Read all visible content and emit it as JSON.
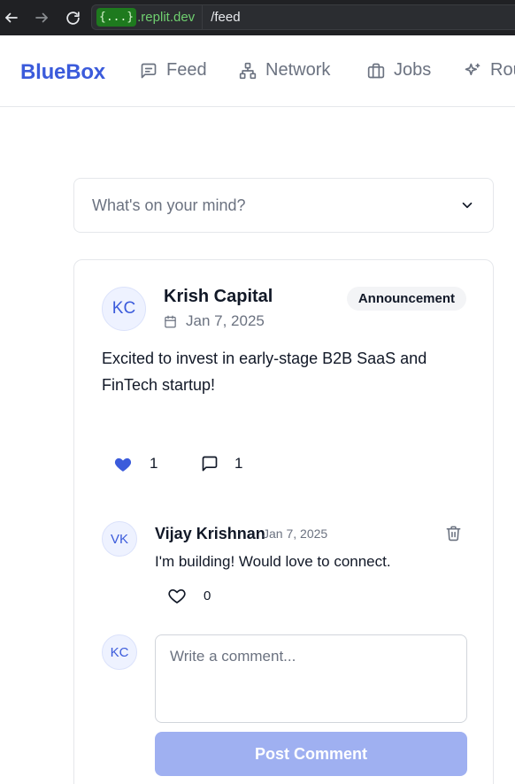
{
  "browser": {
    "host_badge": "{...}",
    "host": ".replit.dev",
    "path": "/feed"
  },
  "header": {
    "brand": "BlueBox",
    "nav": [
      {
        "label": "Feed",
        "icon": "message-square-icon"
      },
      {
        "label": "Network",
        "icon": "network-icon"
      },
      {
        "label": "Jobs",
        "icon": "briefcase-icon"
      },
      {
        "label": "Rou",
        "icon": "sparkles-icon"
      }
    ]
  },
  "composer": {
    "label": "What's on your mind?",
    "icon": "chevron-down-icon"
  },
  "post": {
    "avatar_initials": "KC",
    "author": "Krish Capital",
    "date": "Jan 7, 2025",
    "badge": "Announcement",
    "body": "Excited to invest in early-stage B2B SaaS and FinTech startup!",
    "likes": "1",
    "comments_count": "1",
    "like_color": "#3b5bdb"
  },
  "comments": [
    {
      "avatar_initials": "VK",
      "author": "Vijay Krishnan",
      "date": "Jan 7, 2025",
      "text": "I'm building! Would love to connect.",
      "likes": "0"
    }
  ],
  "new_comment": {
    "avatar_initials": "KC",
    "placeholder": "Write a comment...",
    "button_label": "Post Comment"
  }
}
